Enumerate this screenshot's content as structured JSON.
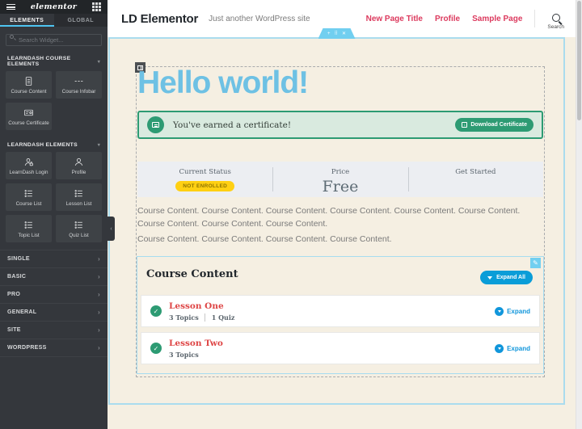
{
  "colors": {
    "accent_blue": "#6EC1E4",
    "panel_tab_underline": "#4EC5F1",
    "learndash_blue": "#1196DB",
    "expand_all_blue": "#0A9DD8",
    "green": "#2D9B73",
    "green_light_bg": "#D9EADF",
    "badge_yellow": "#FFD013",
    "nav_pink": "#DC3A5E",
    "lesson_red": "#DE4545",
    "canvas_cream": "#F5EFE2",
    "outline_blue": "#AADCEE"
  },
  "icons": {
    "add": "+",
    "drag": "⠿",
    "delete": "✕",
    "pencil": "✎",
    "check": "✓",
    "down_arrow": "↓",
    "chevron_right": "›",
    "chevron_down": "▾"
  },
  "panel": {
    "logo": "elementor",
    "tabs": [
      {
        "label": "ELEMENTS",
        "active": true
      },
      {
        "label": "GLOBAL",
        "active": false
      }
    ],
    "search_placeholder": "Search Widget...",
    "sections": [
      {
        "title": "LEARNDASH COURSE ELEMENTS",
        "widgets": [
          {
            "label": "Course Content",
            "icon": "document-icon"
          },
          {
            "label": "Course Infobar",
            "icon": "infobar-icon"
          },
          {
            "label": "Course Certificate",
            "icon": "certificate-icon"
          }
        ]
      },
      {
        "title": "LEARNDASH ELEMENTS",
        "widgets": [
          {
            "label": "LearnDash Login",
            "icon": "user-lock-icon"
          },
          {
            "label": "Profile",
            "icon": "user-icon"
          },
          {
            "label": "Course List",
            "icon": "list-icon"
          },
          {
            "label": "Lesson List",
            "icon": "list-icon"
          },
          {
            "label": "Topic List",
            "icon": "list-icon"
          },
          {
            "label": "Quiz List",
            "icon": "list-icon"
          }
        ]
      }
    ],
    "accordions": [
      "SINGLE",
      "BASIC",
      "PRO",
      "GENERAL",
      "SITE",
      "WORDPRESS"
    ]
  },
  "site_header": {
    "title": "LD Elementor",
    "tagline": "Just another WordPress site",
    "nav": [
      "New Page Title",
      "Profile",
      "Sample Page"
    ],
    "search_label": "Search"
  },
  "page": {
    "heading": "Hello world!",
    "certificate": {
      "message": "You've earned a certificate!",
      "button": "Download Certificate"
    },
    "infobar": {
      "status_label": "Current Status",
      "status_value": "NOT ENROLLED",
      "price_label": "Price",
      "price_value": "Free",
      "cta_label": "Get Started"
    },
    "paragraphs": [
      "Course Content. Course Content. Course Content. Course Content. Course Content. Course Content. Course Content. Course Content. Course Content.",
      "Course Content. Course Content. Course Content. Course Content."
    ],
    "course_content": {
      "heading": "Course Content",
      "expand_all": "Expand All",
      "lessons": [
        {
          "title": "Lesson One",
          "meta_topics": "3 Topics",
          "meta_quiz": "1 Quiz",
          "expand": "Expand"
        },
        {
          "title": "Lesson Two",
          "meta_topics": "3 Topics",
          "expand": "Expand"
        }
      ]
    }
  }
}
